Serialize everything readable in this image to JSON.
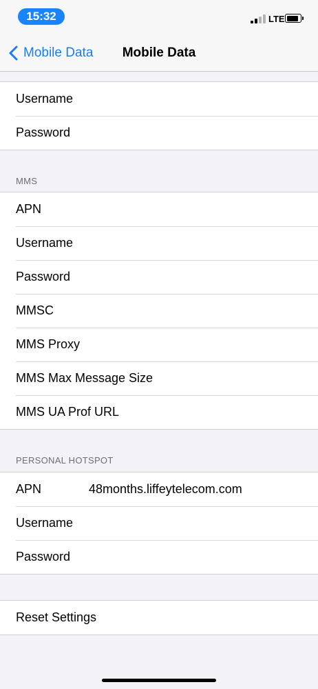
{
  "status_bar": {
    "time": "15:32",
    "network": "LTE",
    "signal_bars_filled": 2,
    "signal_bars_total": 4,
    "battery_level": 0.8
  },
  "nav": {
    "back_label": "Mobile Data",
    "title": "Mobile Data"
  },
  "mobile_data_top": {
    "rows": [
      {
        "label": "Username"
      },
      {
        "label": "Password"
      }
    ]
  },
  "mms": {
    "header": "MMS",
    "rows": [
      {
        "label": "APN"
      },
      {
        "label": "Username"
      },
      {
        "label": "Password"
      },
      {
        "label": "MMSC"
      },
      {
        "label": "MMS Proxy"
      },
      {
        "label": "MMS Max Message Size"
      },
      {
        "label": "MMS UA Prof URL"
      }
    ]
  },
  "hotspot": {
    "header": "PERSONAL HOTSPOT",
    "rows": [
      {
        "label": "APN",
        "value": "48months.liffeytelecom.com"
      },
      {
        "label": "Username"
      },
      {
        "label": "Password"
      }
    ]
  },
  "reset": {
    "label": "Reset Settings"
  },
  "colors": {
    "accent": "#1a7cf5",
    "time_pill": "#1a84ff",
    "background": "#f2f2f7"
  }
}
